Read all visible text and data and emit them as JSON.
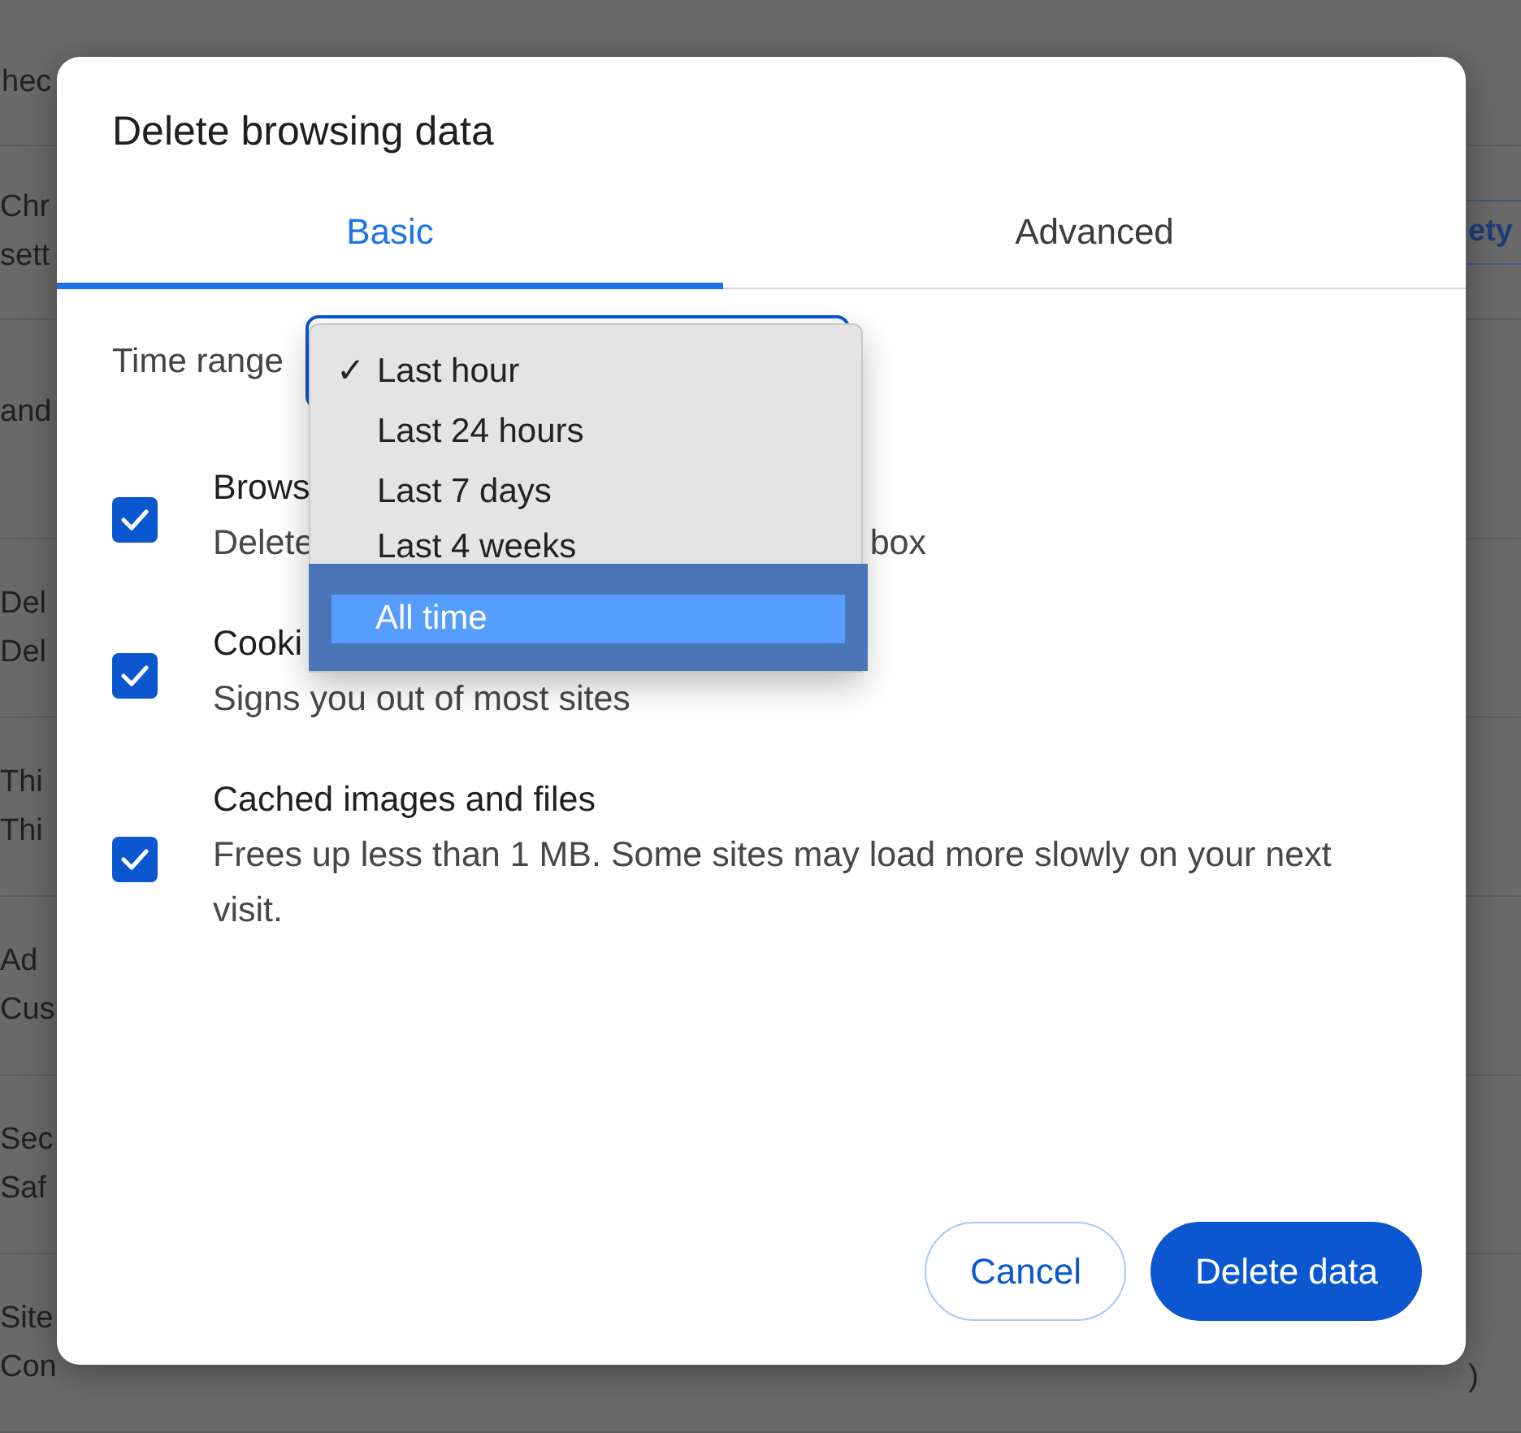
{
  "background_page": {
    "header": "hec",
    "top_row": {
      "title": "Chr",
      "subtitle": "sett"
    },
    "section_heading": "and",
    "rows": [
      {
        "title": "Del",
        "subtitle": "Del"
      },
      {
        "title": "Thi",
        "subtitle": "Thi"
      },
      {
        "title": "Ad",
        "subtitle": "Cus"
      },
      {
        "title": "Sec",
        "subtitle": "Saf"
      },
      {
        "title": "Site",
        "subtitle": "Con"
      }
    ],
    "side_button": "ety",
    "row_end_text": ")"
  },
  "dialog": {
    "title": "Delete browsing data",
    "tabs": [
      {
        "label": "Basic",
        "selected": true
      },
      {
        "label": "Advanced",
        "selected": false
      }
    ],
    "time_range": {
      "label": "Time range"
    },
    "options": [
      {
        "title": "Brows",
        "description": "Delete",
        "description_end": "box",
        "checked": true
      },
      {
        "title": "Cooki",
        "description": "Signs you out of most sites",
        "checked": true
      },
      {
        "title": "Cached images and files",
        "description": "Frees up less than 1 MB. Some sites may load more slowly on your next visit.",
        "checked": true
      }
    ],
    "buttons": [
      {
        "label": "Cancel",
        "kind": "secondary"
      },
      {
        "label": "Delete data",
        "kind": "primary"
      }
    ]
  },
  "dropdown": {
    "check_mark": "✓",
    "items": [
      {
        "label": "Last hour",
        "selected": true,
        "highlighted": false
      },
      {
        "label": "Last 24 hours",
        "selected": false,
        "highlighted": false
      },
      {
        "label": "Last 7 days",
        "selected": false,
        "highlighted": false
      },
      {
        "label": "Last 4 weeks",
        "selected": false,
        "highlighted": false
      },
      {
        "label": "All time",
        "selected": false,
        "highlighted": true
      }
    ]
  }
}
